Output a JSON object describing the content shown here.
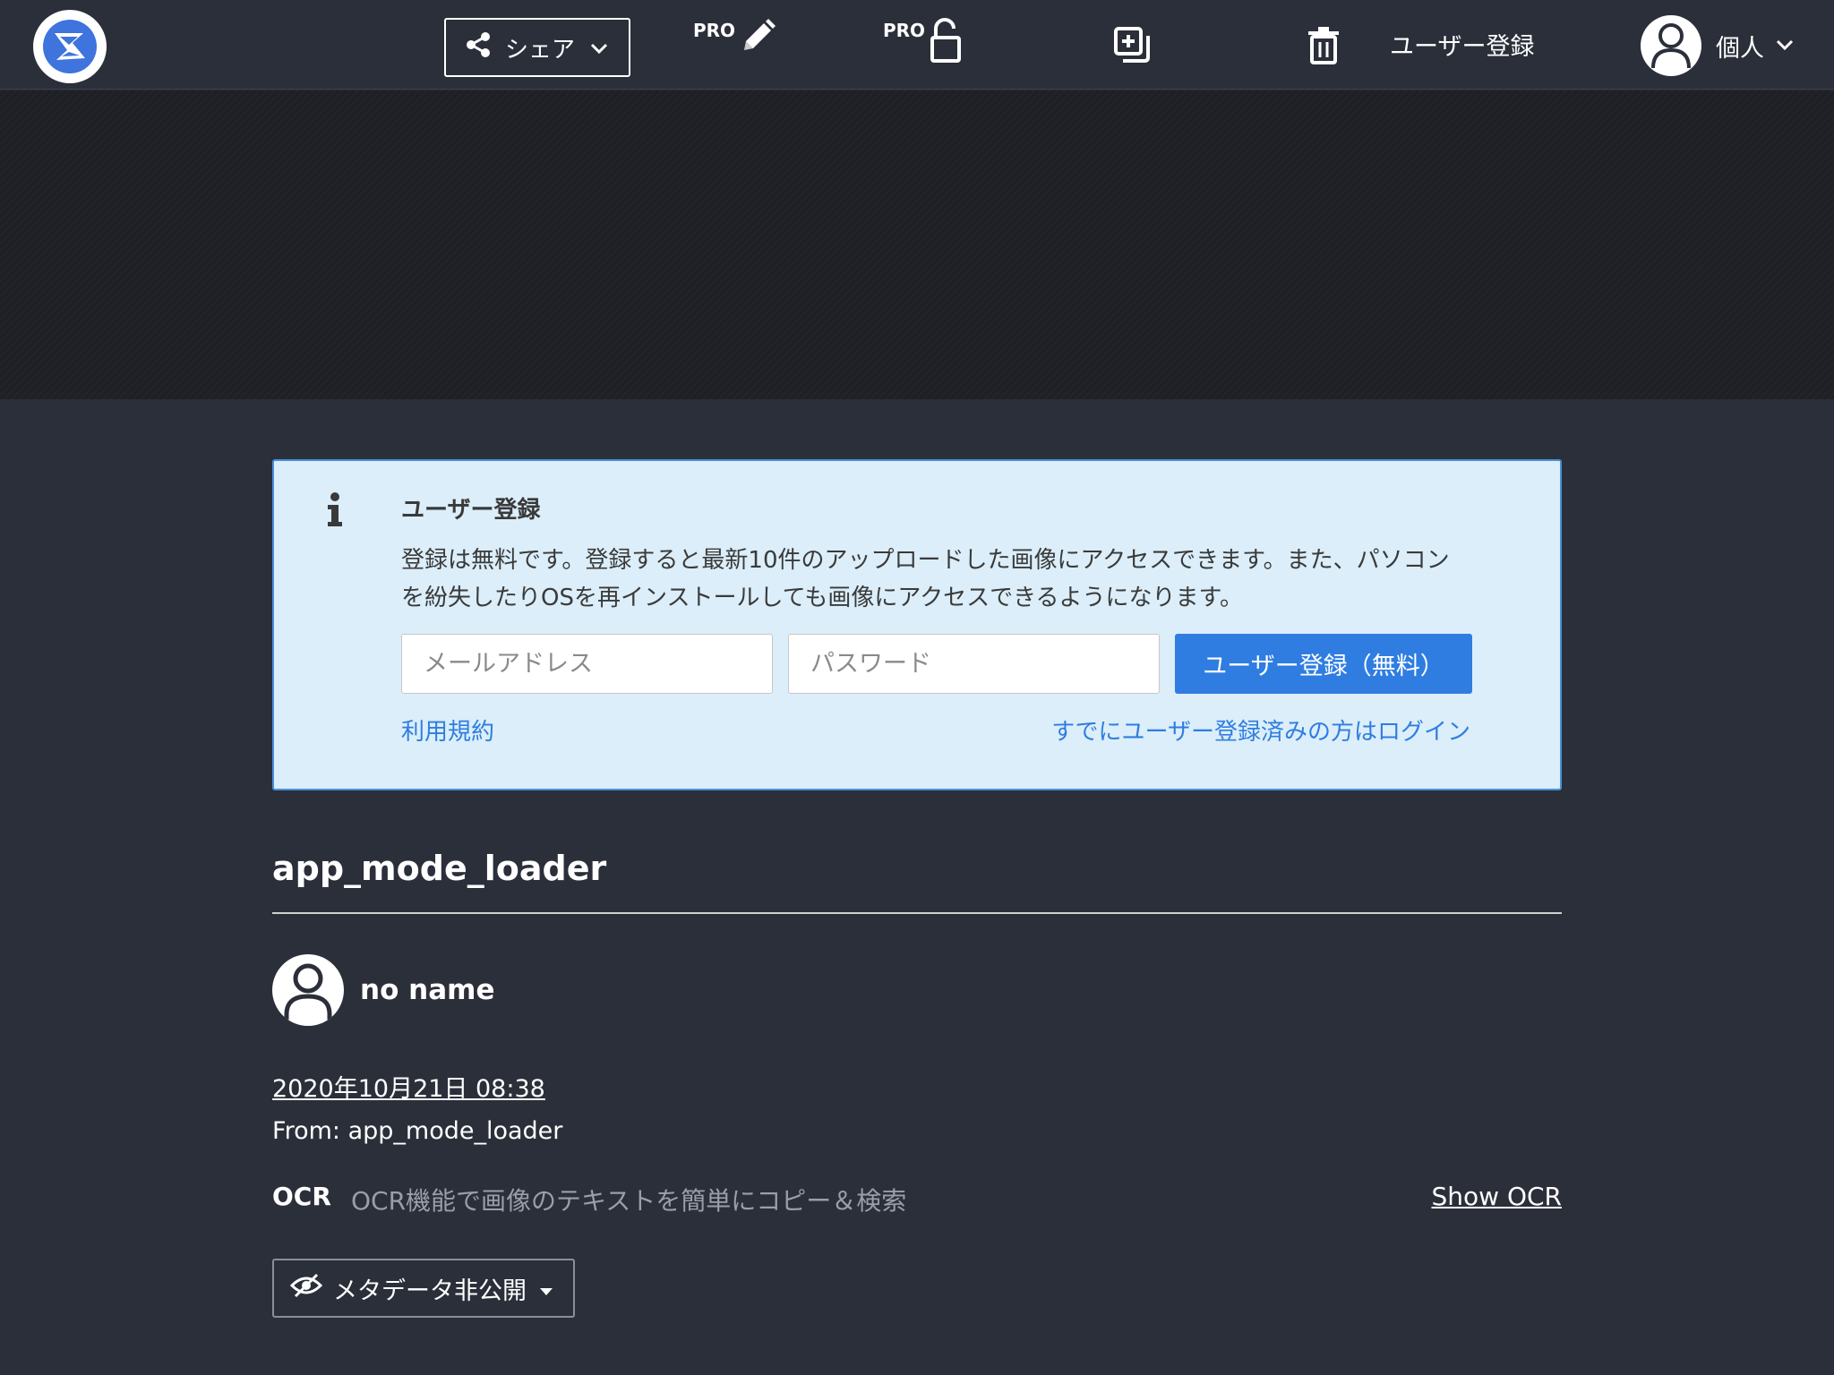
{
  "header": {
    "logo_icon": "app-logo-icon",
    "share_label": "シェア",
    "edit_pro_badge": "PRO",
    "lock_pro_badge": "PRO",
    "register_link": "ユーザー登録",
    "user_label": "個人"
  },
  "info_box": {
    "title": "ユーザー登録",
    "body": "登録は無料です。登録すると最新10件のアップロードした画像にアクセスできます。また、パソコンを紛失したりOSを再インストールしても画像にアクセスできるようになります。",
    "email_placeholder": "メールアドレス",
    "password_placeholder": "パスワード",
    "submit_label": "ユーザー登録（無料）",
    "terms_link": "利用規約",
    "login_link": "すでにユーザー登録済みの方はログイン"
  },
  "content": {
    "title": "app_mode_loader",
    "author_name": "no name",
    "timestamp": "2020年10月21日 08:38",
    "from": "From: app_mode_loader",
    "ocr_label": "OCR",
    "ocr_description": "OCR機能で画像のテキストを簡単にコピー＆検索",
    "show_ocr": "Show OCR",
    "metadata_button": "メタデータ非公開"
  },
  "colors": {
    "background": "#2b2f3a",
    "image_area": "#1e2026",
    "info_bg": "#dbeef9",
    "accent": "#2f7de1",
    "logo_blue": "#3f73de"
  }
}
